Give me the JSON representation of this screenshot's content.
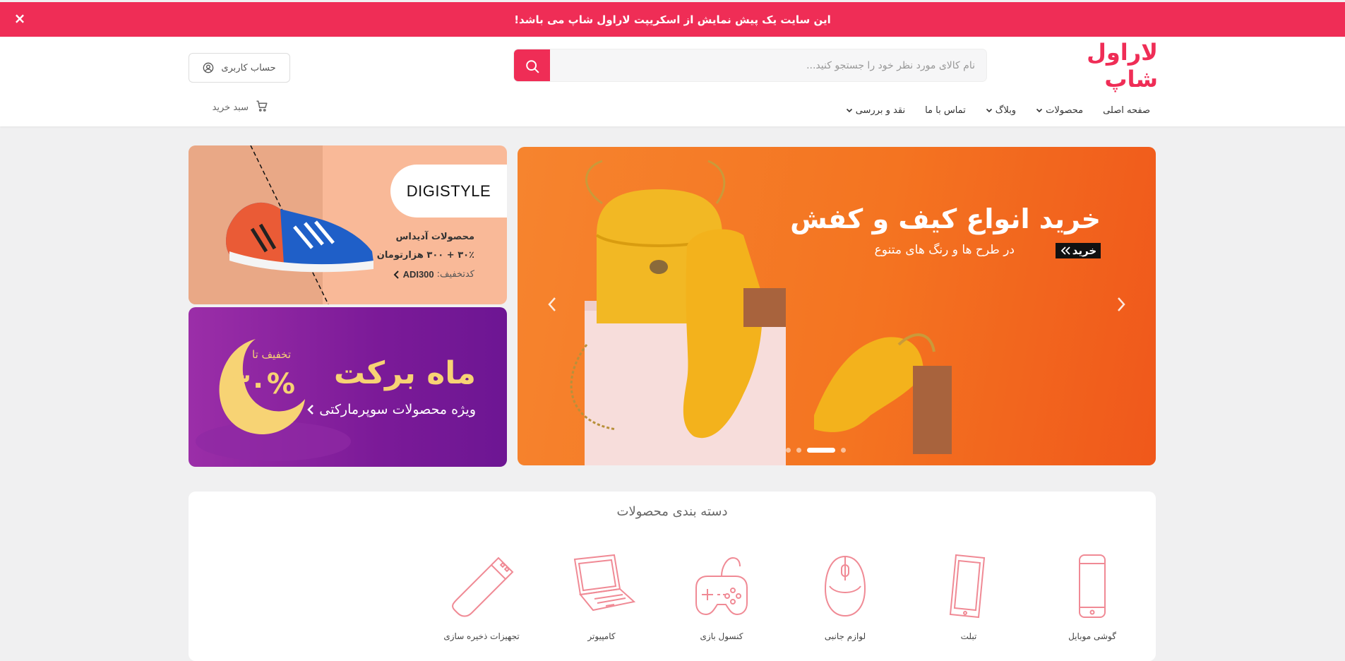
{
  "promo": {
    "message": "این سایت یک پیش نمایش از اسکریپت لاراول شاپ می باشد!",
    "close_icon": "×"
  },
  "header": {
    "logo_text": "لاراول شاپ",
    "search_placeholder": "نام کالای مورد نظر خود را جستجو کنید...",
    "account_label": "حساب کاربری",
    "cart_label": "سبد خرید"
  },
  "nav": {
    "items": [
      {
        "label": "صفحه اصلی",
        "has_dropdown": false
      },
      {
        "label": "محصولات",
        "has_dropdown": true
      },
      {
        "label": "وبلاگ",
        "has_dropdown": true
      },
      {
        "label": "تماس با ما",
        "has_dropdown": false
      },
      {
        "label": "نقد و بررسی",
        "has_dropdown": true
      }
    ]
  },
  "main_slider": {
    "title": "خرید انواع کیف و کفش",
    "subtitle": "در طرح ها و رنگ های متنوع",
    "buy_label": "خرید",
    "total_slides": 5,
    "active_slide": 2
  },
  "side_banners": {
    "shoes": {
      "brand": "DIGISTYLE",
      "line1": "محصولات آدیداس",
      "line2": "۳۰٪ + ۳۰۰ هزارتومان",
      "code_label": "کدتخفیف:",
      "code_value": "ADI300"
    },
    "month": {
      "title": "ماه برکت",
      "subtitle": "ویژه محصولات سوپرمارکتی",
      "discount_up_to": "تخفیف تا",
      "discount_value": "۳۰%"
    }
  },
  "categories": {
    "title": "دسته بندی محصولات",
    "items": [
      {
        "label": "گوشی موبایل",
        "icon": "mobile-icon"
      },
      {
        "label": "تبلت",
        "icon": "tablet-icon"
      },
      {
        "label": "لوازم جانبی",
        "icon": "mouse-icon"
      },
      {
        "label": "کنسول بازی",
        "icon": "gamepad-icon"
      },
      {
        "label": "کامپیوتر",
        "icon": "laptop-icon"
      },
      {
        "label": "تجهیزات ذخیره سازی",
        "icon": "usb-drive-icon"
      }
    ]
  },
  "colors": {
    "accent": "#ef2d56",
    "category_icon": "#f08a95"
  }
}
